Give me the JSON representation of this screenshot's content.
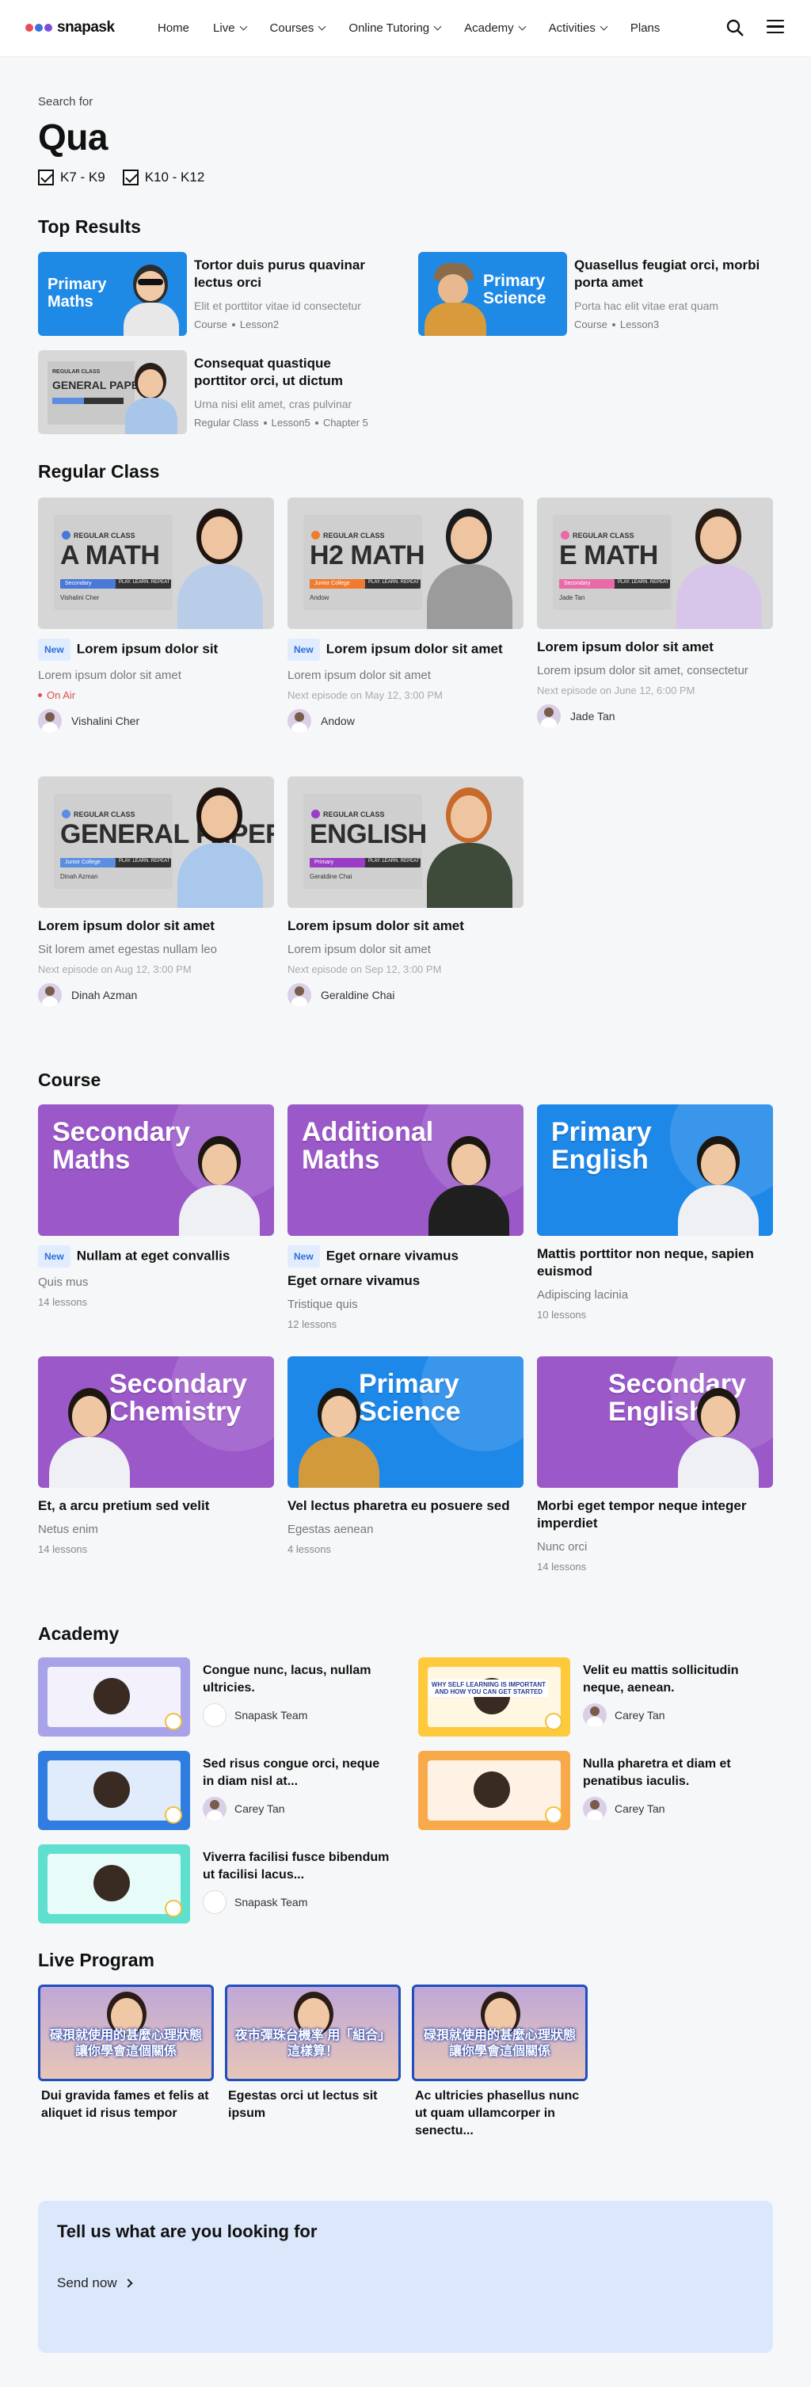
{
  "nav": {
    "brand": "snapask",
    "items": [
      {
        "label": "Home",
        "has_dropdown": false
      },
      {
        "label": "Live",
        "has_dropdown": true
      },
      {
        "label": "Courses",
        "has_dropdown": true
      },
      {
        "label": "Online Tutoring",
        "has_dropdown": true
      },
      {
        "label": "Academy",
        "has_dropdown": true
      },
      {
        "label": "Activities",
        "has_dropdown": true
      },
      {
        "label": "Plans",
        "has_dropdown": false
      }
    ],
    "search_icon": "search-icon",
    "menu_icon": "hamburger-menu-icon"
  },
  "search": {
    "label": "Search for",
    "query": "Qua",
    "filters": [
      {
        "label": "K7 - K9",
        "checked": true
      },
      {
        "label": "K10 - K12",
        "checked": true
      }
    ]
  },
  "top_results": {
    "heading": "Top Results",
    "items": [
      {
        "thumb_text": "Primary Maths",
        "title": "Tortor duis purus quavinar lectus orci",
        "desc": "Elit et porttitor vitae id consectetur",
        "meta": [
          "Course",
          "Lesson2"
        ]
      },
      {
        "thumb_text": "Primary Science",
        "title": "Quasellus feugiat orci, morbi porta amet",
        "desc": "Porta hac elit vitae erat quam",
        "meta": [
          "Course",
          "Lesson3"
        ]
      },
      {
        "thumb_text": "GENERAL PAPER",
        "title": "Consequat quastique porttitor orci, ut dictum",
        "desc": "Urna nisi elit amet, cras pulvinar",
        "meta": [
          "Regular Class",
          "Lesson5",
          "Chapter 5"
        ]
      }
    ]
  },
  "regular_class": {
    "heading": "Regular Class",
    "badge_label": "REGULAR CLASS",
    "pill_tag": "PLAY. LEARN. REPEAT",
    "items": [
      {
        "subject": "A MATH",
        "level": "Secondary",
        "accent": "#4a78d8",
        "is_new": true,
        "title": "Lorem ipsum dolor sit",
        "desc": "Lorem ipsum dolor sit amet",
        "status": "On Air",
        "teacher": "Vishalini Cher"
      },
      {
        "subject": "H2 MATH",
        "level": "Junior College",
        "accent": "#f07a2e",
        "is_new": true,
        "title": "Lorem ipsum dolor sit amet",
        "desc": "Lorem ipsum dolor sit amet",
        "status": "Next episode on May 12, 3:00 PM",
        "teacher": "Andow"
      },
      {
        "subject": "E MATH",
        "level": "Secondary",
        "accent": "#e86aa6",
        "is_new": false,
        "title": "Lorem ipsum dolor sit amet",
        "desc": "Lorem ipsum dolor sit amet, consectetur",
        "status": "Next episode on June 12, 6:00 PM",
        "teacher": "Jade Tan"
      },
      {
        "subject": "GENERAL PAPER",
        "level": "Junior College",
        "accent": "#5b8de0",
        "is_new": false,
        "title": "Lorem ipsum dolor sit amet",
        "desc": "Sit lorem amet egestas nullam leo",
        "status": "Next episode on Aug 12, 3:00 PM",
        "teacher": "Dinah Azman"
      },
      {
        "subject": "ENGLISH",
        "level": "Primary",
        "accent": "#9b3cc7",
        "is_new": false,
        "title": "Lorem ipsum dolor sit amet",
        "desc": "Lorem ipsum dolor sit amet",
        "status": "Next episode on Sep 12, 3:00 PM",
        "teacher": "Geraldine Chai"
      }
    ]
  },
  "course": {
    "heading": "Course",
    "items": [
      {
        "banner": "Secondary Maths",
        "bg": "#9b58c9",
        "is_new": true,
        "title": "Nullam at eget convallis",
        "title2": "",
        "desc": "Quis mus",
        "lessons": "14 lessons"
      },
      {
        "banner": "Additional Maths",
        "bg": "#9b58c9",
        "is_new": true,
        "title": "Eget ornare vivamus",
        "title2": "Eget ornare vivamus",
        "desc": "Tristique quis",
        "lessons": "12 lessons"
      },
      {
        "banner": "Primary English",
        "bg": "#1e88e8",
        "is_new": false,
        "title": "Mattis porttitor non neque, sapien euismod",
        "title2": "",
        "desc": "Adipiscing lacinia",
        "lessons": "10 lessons"
      },
      {
        "banner": "Secondary Chemistry",
        "bg": "#9b58c9",
        "is_new": false,
        "title": "Et, a arcu pretium sed velit",
        "title2": "",
        "desc": "Netus enim",
        "lessons": "14 lessons"
      },
      {
        "banner": "Primary Science",
        "bg": "#1e88e8",
        "is_new": false,
        "title": "Vel lectus pharetra eu posuere sed",
        "title2": "",
        "desc": "Egestas aenean",
        "lessons": "4 lessons"
      },
      {
        "banner": "Secondary English",
        "bg": "#9b58c9",
        "is_new": false,
        "title": "Morbi eget tempor neque integer imperdiet",
        "title2": "",
        "desc": "Nunc orci",
        "lessons": "14 lessons"
      }
    ]
  },
  "academy": {
    "heading": "Academy",
    "items": [
      {
        "title": "Congue nunc, lacus, nullam ultricies.",
        "author": "Snapask Team",
        "bg": "#a8a3e8"
      },
      {
        "title": "Velit eu mattis sollicitudin neque, aenean.",
        "author": "Carey Tan",
        "bg": "#ffc93c",
        "thumb_text": "WHY SELF LEARNING IS IMPORTANT AND HOW YOU CAN GET STARTED"
      },
      {
        "title": "Sed risus congue orci, neque in diam nisl at...",
        "author": "Carey Tan",
        "bg": "#2f7de0"
      },
      {
        "title": "Nulla pharetra et diam et penatibus iaculis.",
        "author": "Carey Tan",
        "bg": "#f8a94a"
      },
      {
        "title": "Viverra facilisi fusce bibendum ut facilisi lacus...",
        "author": "Snapask Team",
        "bg": "#5fe0cf"
      }
    ]
  },
  "live_program": {
    "heading": "Live Program",
    "items": [
      {
        "title": "Dui gravida fames et felis at aliquet id risus tempor",
        "thumb_text": "碌孭就使用的甚麼心理狀態 讓你學會這個關係"
      },
      {
        "title": "Egestas orci ut lectus sit ipsum",
        "thumb_text": "夜市彈珠台機率 用「組合」這樣算！"
      },
      {
        "title": "Ac ultricies phasellus nunc ut quam ullamcorper in senectu...",
        "thumb_text": "碌孭就使用的甚麼心理狀態 讓你學會這個關係"
      }
    ]
  },
  "cta": {
    "title": "Tell us what are you looking for",
    "button": "Send now"
  },
  "labels": {
    "new": "New",
    "on_air": "On Air"
  }
}
